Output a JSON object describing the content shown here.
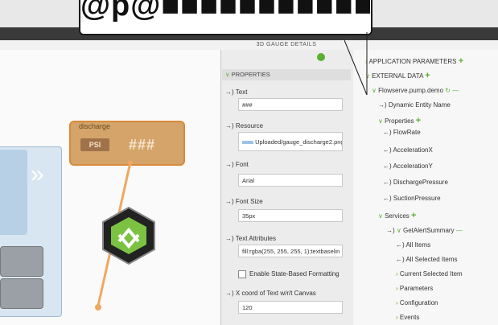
{
  "header": {
    "callout_text": "@p@■■■■■■■■■■■■g■■■■■"
  },
  "properties_panel": {
    "title": "3D GAUGE DETAILS",
    "section": "PROPERTIES",
    "fields": [
      {
        "label": "Text",
        "value": "###"
      },
      {
        "label": "Resource",
        "value": "Uploaded/gauge_discharge2.png"
      },
      {
        "label": "Font",
        "value": "Arial"
      },
      {
        "label": "Font Size",
        "value": "35px"
      },
      {
        "label": "Text Attributes",
        "value": "fill:rgba(255, 255, 255, 1);textbaselin"
      },
      {
        "label": "X coord of Text w/r/t Canvas",
        "value": "120"
      }
    ],
    "checkbox_label": "Enable State-Based Formatting"
  },
  "data_panel": {
    "app_params": "APPLICATION PARAMETERS",
    "external_data": "EXTERNAL DATA",
    "thing": "Flowserve.pump.demo",
    "dynamic_entity": "Dynamic Entity Name",
    "properties": "Properties",
    "props": [
      "FlowRate",
      "AccelerationX",
      "AccelerationY",
      "DischargePressure",
      "SuctionPressure"
    ],
    "services": "Services",
    "service_name": "GetAlertSummary",
    "service_children": [
      "All Items",
      "All Selected Items",
      "Current Selected Item",
      "Parameters",
      "Configuration",
      "Events"
    ]
  },
  "canvas": {
    "gauge_label": "discharge",
    "gauge_value": "###",
    "psi": "PSI"
  }
}
